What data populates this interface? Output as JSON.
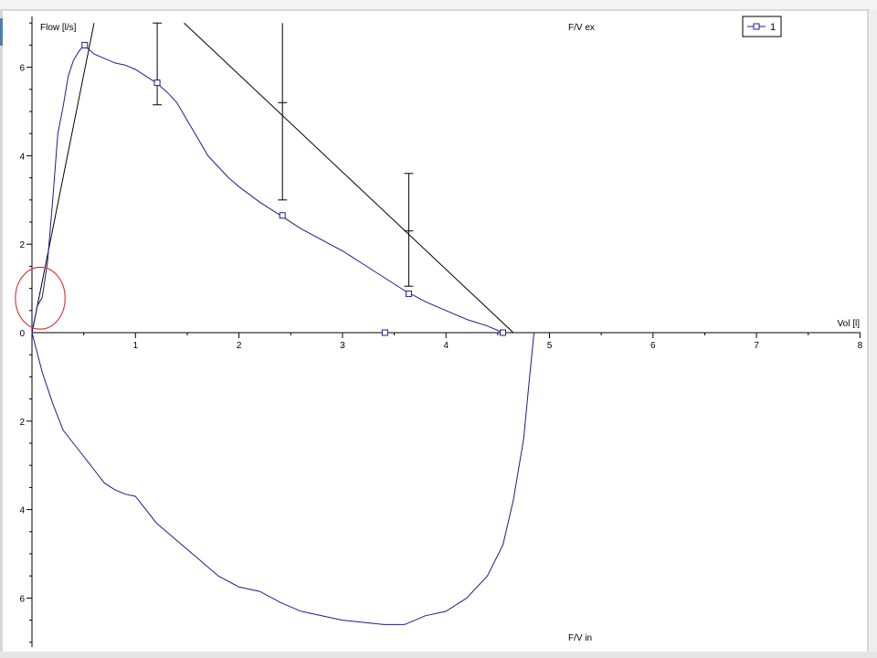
{
  "chart_data": {
    "type": "line",
    "title": "",
    "xlabel": "Vol [l]",
    "ylabel": "Flow [l/s]",
    "panel_labels": {
      "expiration": "F/V ex",
      "inspiration": "F/V in"
    },
    "xlim": [
      0,
      8
    ],
    "ylim_expiration": [
      0,
      7
    ],
    "ylim_inspiration": [
      0,
      7
    ],
    "x_ticks": [
      "1",
      "2",
      "3",
      "4",
      "5",
      "6",
      "7",
      "8"
    ],
    "y_ticks_expiration": [
      "6",
      "4",
      "2",
      "0"
    ],
    "y_ticks_inspiration": [
      "2",
      "4",
      "6"
    ],
    "legend": {
      "label": "1",
      "placement": "top-right"
    },
    "colors": {
      "series": "#1c1c8c",
      "reference": "#000000",
      "axis": "#000000",
      "annotation": "#d94040",
      "frame": "#b4b4b4",
      "background": "#ffffff"
    },
    "series_expiration": {
      "name": "1",
      "x": [
        0,
        0.05,
        0.1,
        0.15,
        0.2,
        0.25,
        0.3,
        0.35,
        0.4,
        0.45,
        0.5,
        0.6,
        0.7,
        0.8,
        0.9,
        1.0,
        1.1,
        1.2,
        1.3,
        1.4,
        1.5,
        1.6,
        1.7,
        1.8,
        1.9,
        2.0,
        2.2,
        2.4,
        2.6,
        2.8,
        3.0,
        3.2,
        3.4,
        3.6,
        3.8,
        4.0,
        4.2,
        4.4,
        4.55
      ],
      "y": [
        0,
        0.6,
        0.8,
        1.6,
        3.0,
        4.5,
        5.1,
        5.8,
        6.15,
        6.35,
        6.5,
        6.3,
        6.2,
        6.1,
        6.05,
        5.95,
        5.8,
        5.65,
        5.45,
        5.2,
        4.8,
        4.4,
        4.0,
        3.75,
        3.5,
        3.3,
        2.95,
        2.65,
        2.35,
        2.1,
        1.85,
        1.55,
        1.25,
        0.95,
        0.7,
        0.5,
        0.3,
        0.15,
        0
      ]
    },
    "series_inspiration": {
      "x": [
        0,
        0.1,
        0.2,
        0.3,
        0.4,
        0.5,
        0.6,
        0.7,
        0.8,
        0.9,
        1.0,
        1.2,
        1.4,
        1.6,
        1.8,
        2.0,
        2.2,
        2.4,
        2.6,
        2.8,
        3.0,
        3.2,
        3.4,
        3.6,
        3.8,
        4.0,
        4.2,
        4.4,
        4.55,
        4.65,
        4.75,
        4.8,
        4.85
      ],
      "y": [
        0,
        0.9,
        1.6,
        2.2,
        2.5,
        2.8,
        3.1,
        3.4,
        3.55,
        3.65,
        3.7,
        4.3,
        4.7,
        5.1,
        5.5,
        5.75,
        5.85,
        6.1,
        6.3,
        6.4,
        6.5,
        6.55,
        6.6,
        6.6,
        6.4,
        6.3,
        6.0,
        5.5,
        4.8,
        3.8,
        2.4,
        1.2,
        0
      ]
    },
    "markers": [
      {
        "x": 0.51,
        "y": 6.5
      },
      {
        "x": 1.21,
        "y": 5.65
      },
      {
        "x": 2.42,
        "y": 2.65
      },
      {
        "x": 3.64,
        "y": 0.88
      },
      {
        "x": 4.55,
        "y": 0
      },
      {
        "x": 3.41,
        "y": 0
      }
    ],
    "error_bars": [
      {
        "x": 1.21,
        "center": 7.0,
        "low": 5.15,
        "high": 7.0
      },
      {
        "x": 2.42,
        "center": 5.2,
        "low": 3.0,
        "high": 7.0
      },
      {
        "x": 3.64,
        "center": 2.3,
        "low": 1.05,
        "high": 3.6
      }
    ],
    "reference_lines": [
      {
        "x1": 0,
        "y1": 0,
        "x2": 0.6,
        "y2": 7.0
      },
      {
        "x1": 1.47,
        "y1": 7.0,
        "x2": 4.65,
        "y2": 0
      }
    ],
    "annotation_ellipse": {
      "cx": 0.08,
      "cy": 0.78,
      "rx": 0.24,
      "ry": 0.7
    }
  }
}
